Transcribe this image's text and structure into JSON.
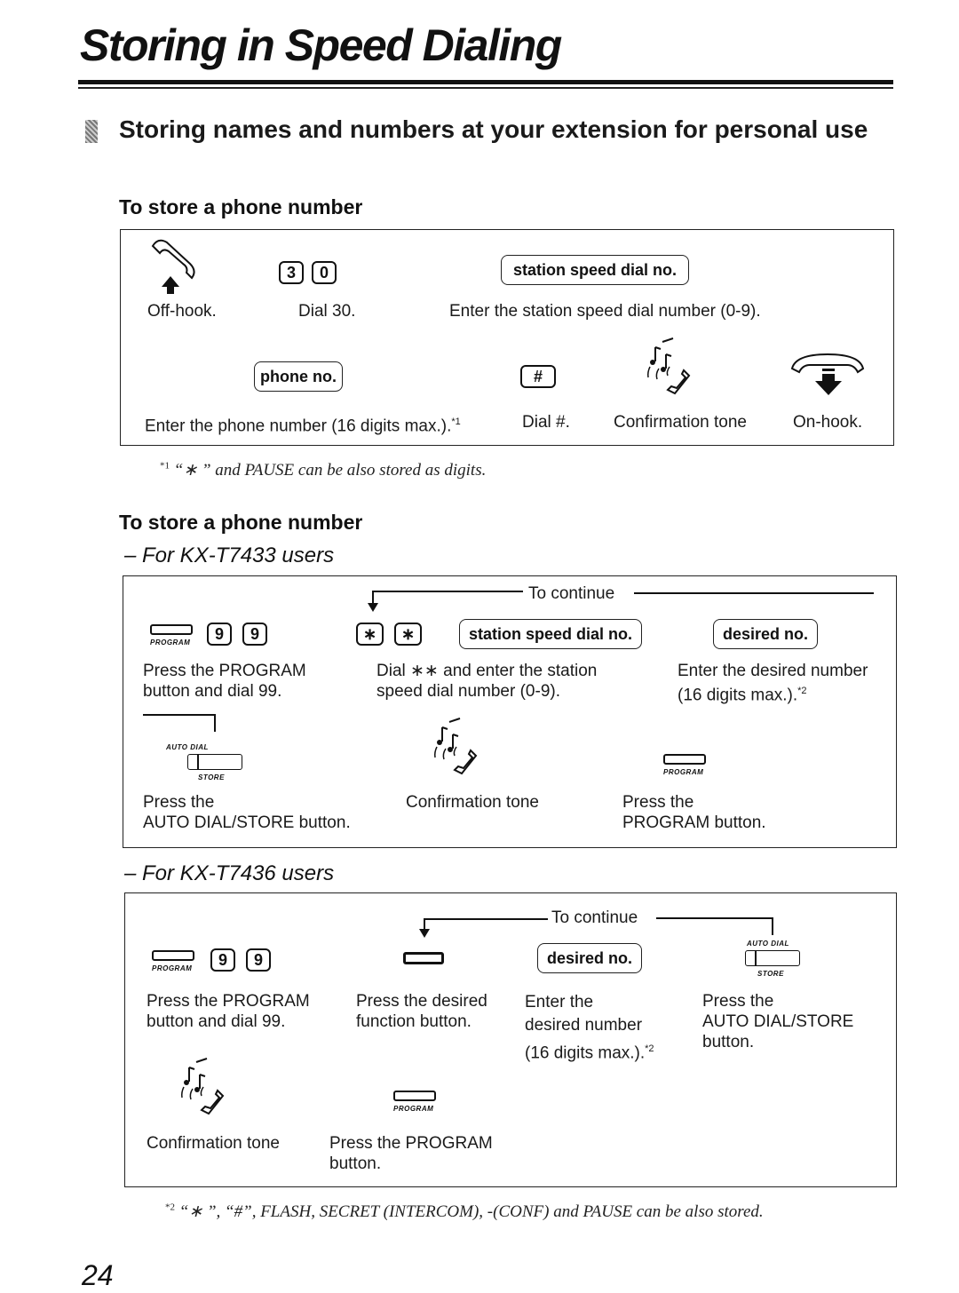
{
  "page": {
    "title": "Storing in Speed Dialing",
    "section_heading": "Storing names and numbers at your extension for personal use",
    "page_number": "24"
  },
  "block1": {
    "heading": "To store a phone number",
    "row1": [
      {
        "icon": "off-hook-icon",
        "caption": "Off-hook."
      },
      {
        "keys": [
          "3",
          "0"
        ],
        "caption": "Dial 30."
      },
      {
        "field": "station speed dial no.",
        "caption": "Enter the station speed dial number (0-9)."
      }
    ],
    "row2": [
      {
        "field": "phone no.",
        "caption": "Enter the phone number (16 digits max.).",
        "note_ref": "*1"
      },
      {
        "keys": [
          "#"
        ],
        "caption": "Dial #."
      },
      {
        "icon": "confirmation-tone-icon",
        "caption": "Confirmation tone"
      },
      {
        "icon": "on-hook-icon",
        "caption": "On-hook."
      }
    ],
    "footnote": {
      "ref": "*1",
      "text": "“∗ ” and PAUSE can be also stored as digits."
    }
  },
  "block2": {
    "heading": "To store a phone number",
    "kx7433": {
      "model_label": "– For KX-T7433 users",
      "continue_label": "To continue",
      "row1": [
        {
          "button_label": "PROGRAM",
          "keys": [
            "9",
            "9"
          ],
          "caption": [
            "Press the PROGRAM",
            "button and dial 99."
          ]
        },
        {
          "keys": [
            "∗",
            "∗"
          ],
          "field": "station speed dial no.",
          "caption": [
            "Dial ∗∗ and enter the station",
            "speed dial number (0-9)."
          ]
        },
        {
          "field": "desired no.",
          "caption": [
            "Enter the desired number",
            "(16 digits max.)."
          ],
          "note_ref": "*2"
        }
      ],
      "row2": [
        {
          "button_top": "AUTO DIAL",
          "button_bottom": "STORE",
          "caption": [
            "Press the",
            "AUTO DIAL/STORE button."
          ]
        },
        {
          "icon": "confirmation-tone-icon",
          "caption": [
            "Confirmation tone"
          ]
        },
        {
          "button_label": "PROGRAM",
          "caption": [
            "Press the",
            "PROGRAM button."
          ]
        }
      ]
    },
    "kx7436": {
      "model_label": "– For KX-T7436 users",
      "continue_label": "To continue",
      "row1": [
        {
          "button_label": "PROGRAM",
          "keys": [
            "9",
            "9"
          ],
          "caption": [
            "Press the PROGRAM",
            "button and dial 99."
          ]
        },
        {
          "caption": [
            "Press the desired",
            "function button."
          ]
        },
        {
          "field": "desired no.",
          "caption": [
            "Enter the",
            "desired number",
            "(16 digits max.)."
          ],
          "note_ref": "*2"
        },
        {
          "button_top": "AUTO DIAL",
          "button_bottom": "STORE",
          "caption": [
            "Press the",
            "AUTO DIAL/STORE",
            "button."
          ]
        }
      ],
      "row2": [
        {
          "icon": "confirmation-tone-icon",
          "caption": [
            "Confirmation tone"
          ]
        },
        {
          "button_label": "PROGRAM",
          "caption": [
            "Press the PROGRAM",
            "button."
          ]
        }
      ]
    },
    "footnote": {
      "ref": "*2",
      "text": "“∗ ”, “#”, FLASH, SECRET (INTERCOM), -(CONF) and PAUSE can be also stored."
    }
  }
}
